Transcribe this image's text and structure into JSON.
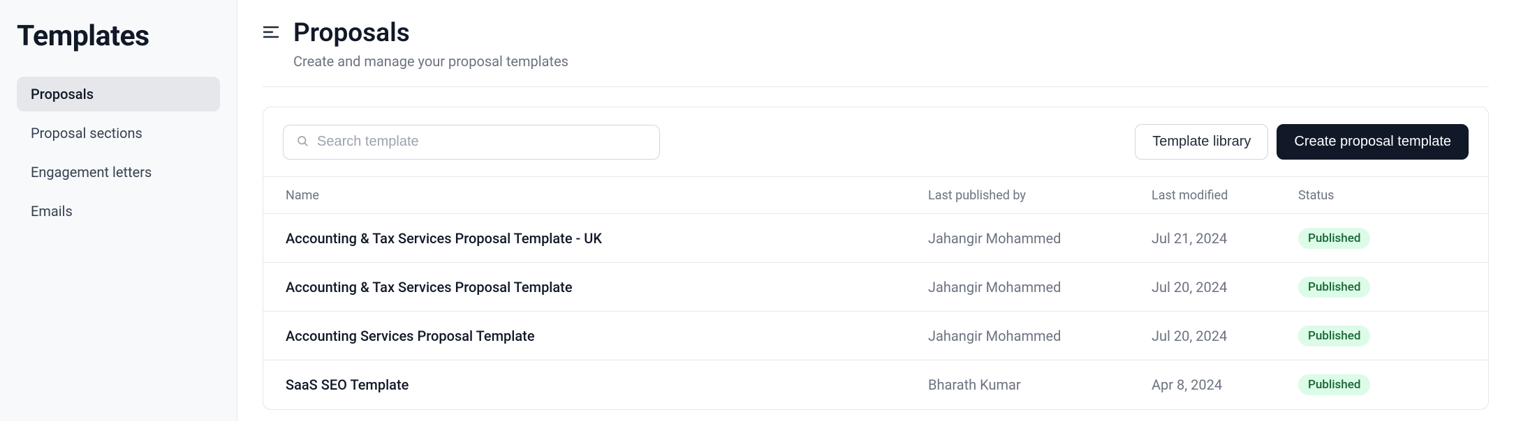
{
  "sidebar": {
    "title": "Templates",
    "items": [
      {
        "label": "Proposals",
        "active": true
      },
      {
        "label": "Proposal sections",
        "active": false
      },
      {
        "label": "Engagement letters",
        "active": false
      },
      {
        "label": "Emails",
        "active": false
      }
    ]
  },
  "header": {
    "title": "Proposals",
    "subtitle": "Create and manage your proposal templates"
  },
  "toolbar": {
    "search_placeholder": "Search template",
    "library_label": "Template library",
    "create_label": "Create proposal template"
  },
  "table": {
    "columns": {
      "name": "Name",
      "published_by": "Last published by",
      "modified": "Last modified",
      "status": "Status"
    },
    "rows": [
      {
        "name": "Accounting & Tax Services Proposal Template - UK",
        "published_by": "Jahangir Mohammed",
        "modified": "Jul 21, 2024",
        "status": "Published"
      },
      {
        "name": "Accounting & Tax Services Proposal Template",
        "published_by": "Jahangir Mohammed",
        "modified": "Jul 20, 2024",
        "status": "Published"
      },
      {
        "name": "Accounting Services Proposal Template",
        "published_by": "Jahangir Mohammed",
        "modified": "Jul 20, 2024",
        "status": "Published"
      },
      {
        "name": "SaaS SEO Template",
        "published_by": "Bharath Kumar",
        "modified": "Apr 8, 2024",
        "status": "Published"
      }
    ]
  }
}
